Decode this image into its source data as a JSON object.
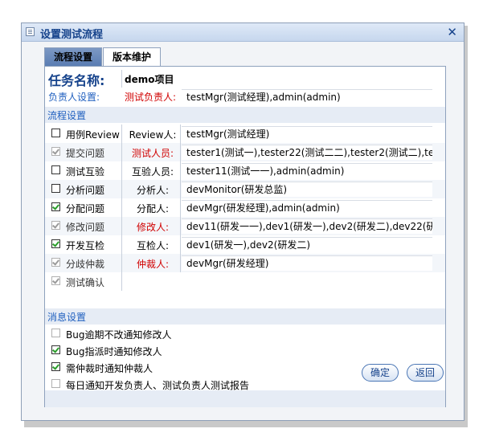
{
  "window": {
    "title": "设置测试流程"
  },
  "tabs": [
    {
      "label": "流程设置",
      "active": true
    },
    {
      "label": "版本维护",
      "active": false
    }
  ],
  "task": {
    "label": "任务名称:",
    "name": "demo项目"
  },
  "owner": {
    "label": "负责人设置:",
    "test_owner_label": "测试负责人:",
    "test_owner_value": "testMgr(测试经理),admin(admin)"
  },
  "sections": {
    "flow": "流程设置",
    "message": "消息设置"
  },
  "flow_rows": [
    {
      "check": "用例Review",
      "checked": false,
      "disabled": false,
      "role": "Review人:",
      "role_red": false,
      "value": "testMgr(测试经理)"
    },
    {
      "check": "提交问题",
      "checked": true,
      "disabled": true,
      "role": "测试人员:",
      "role_red": true,
      "value": "tester1(测试一),tester22(测试二二),tester2(测试二),tes"
    },
    {
      "check": "测试互验",
      "checked": false,
      "disabled": false,
      "role": "互验人员:",
      "role_red": false,
      "value": "tester11(测试一一),admin(admin)"
    },
    {
      "check": "分析问题",
      "checked": false,
      "disabled": false,
      "role": "分析人:",
      "role_red": false,
      "value": "devMonitor(研发总监)"
    },
    {
      "check": "分配问题",
      "checked": true,
      "disabled": false,
      "role": "分配人:",
      "role_red": false,
      "value": "devMgr(研发经理),admin(admin)"
    },
    {
      "check": "修改问题",
      "checked": true,
      "disabled": true,
      "role": "修改人:",
      "role_red": true,
      "value": "dev11(研发一一),dev1(研发一),dev2(研发二),dev22(研发"
    },
    {
      "check": "开发互检",
      "checked": true,
      "disabled": false,
      "role": "互检人:",
      "role_red": false,
      "value": "dev1(研发一),dev2(研发二)"
    },
    {
      "check": "分歧仲裁",
      "checked": true,
      "disabled": true,
      "role": "仲裁人:",
      "role_red": true,
      "value": "devMgr(研发经理)"
    },
    {
      "check": "测试确认",
      "checked": true,
      "disabled": true,
      "role": "",
      "role_red": false,
      "value": ""
    }
  ],
  "message_rows": [
    {
      "label": "Bug逾期不改通知修改人",
      "checked": false,
      "disabled": true
    },
    {
      "label": "Bug指派时通知修改人",
      "checked": true,
      "disabled": false
    },
    {
      "label": "需仲裁时通知仲裁人",
      "checked": true,
      "disabled": false
    },
    {
      "label": "每日通知开发负责人、测试负责人测试报告",
      "checked": false,
      "disabled": true
    }
  ],
  "buttons": {
    "confirm": "确定",
    "back": "返回"
  }
}
